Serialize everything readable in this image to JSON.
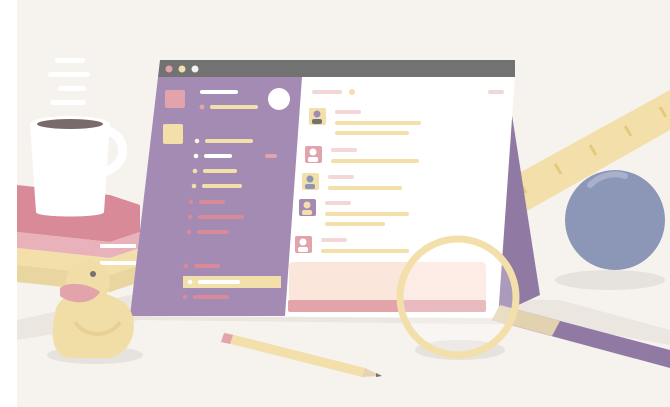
{
  "illustration": {
    "subject": "chat-app-window-with-desk-objects",
    "objects": [
      "coffee-mug",
      "books",
      "rubber-duck",
      "pencil",
      "magnifying-glass",
      "ruler",
      "ball",
      "laptop-window"
    ],
    "window": {
      "traffic_lights": 3,
      "sidebar_items": 10,
      "message_rows": 5,
      "has_composer": true
    },
    "palette": {
      "background": "#f6f2ee",
      "purple": "#a38bb3",
      "purple_dark": "#9079a3",
      "window_bar": "#727272",
      "pink": "#e2a3ab",
      "yellow": "#f3dfaa",
      "blue_ball": "#8c96b6",
      "duck": "#f1dea6",
      "mug": "#ffffff"
    }
  }
}
